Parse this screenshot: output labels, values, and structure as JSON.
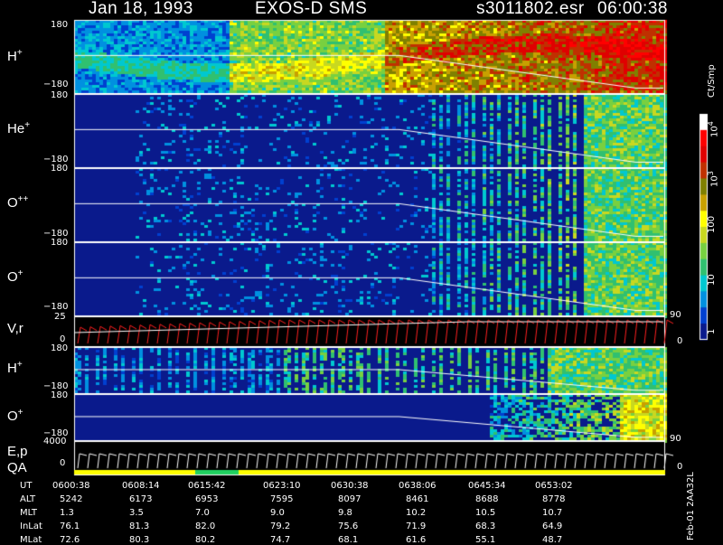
{
  "header": {
    "date": "Jan 18, 1993",
    "instrument": "EXOS-D SMS",
    "file": "s3011802.esr",
    "time": "06:00:38"
  },
  "colorbar": {
    "unit": "Ct/Smp",
    "labels": [
      "10",
      "3",
      "10",
      "4",
      "100",
      "10",
      "1"
    ],
    "exponent_labels": {
      "e3": "3",
      "e4": "4"
    },
    "level_colors": [
      "#0a1a8c",
      "#0040d0",
      "#0090e0",
      "#00c8d0",
      "#30c070",
      "#78d040",
      "#c8d820",
      "#ffff00",
      "#c8a000",
      "#808000",
      "#c03000",
      "#e00000",
      "#ff0000",
      "#ffffff"
    ]
  },
  "footer_note": "Feb-01  2AA32L",
  "chart_data": [
    {
      "type": "heatmap",
      "label": {
        "base": "H",
        "sup": "+"
      },
      "yticks": [
        "180",
        "−180"
      ],
      "ylim": [
        -180,
        180
      ]
    },
    {
      "type": "heatmap",
      "label": {
        "base": "He",
        "sup": "+"
      },
      "yticks": [
        "180",
        "−180"
      ],
      "ylim": [
        -180,
        180
      ]
    },
    {
      "type": "heatmap",
      "label": {
        "base": "O",
        "sup": "++"
      },
      "yticks": [
        "180",
        "−180"
      ],
      "ylim": [
        -180,
        180
      ]
    },
    {
      "type": "heatmap",
      "label": {
        "base": "O",
        "sup": "+"
      },
      "yticks": [
        "180",
        "−180"
      ],
      "ylim": [
        -180,
        180
      ]
    },
    {
      "type": "line",
      "label": {
        "base": "V,r",
        "sup": ""
      },
      "yticks": [
        "25",
        "0"
      ],
      "right_ticks": [
        "90",
        "0"
      ],
      "ylim": [
        0,
        25
      ]
    },
    {
      "type": "heatmap",
      "label": {
        "base": "H",
        "sup": "+"
      },
      "yticks": [
        "180",
        "−180"
      ],
      "ylim": [
        -180,
        180
      ]
    },
    {
      "type": "heatmap",
      "label": {
        "base": "O",
        "sup": "+"
      },
      "yticks": [
        "180",
        "−180"
      ],
      "ylim": [
        -180,
        180
      ],
      "right_ticks": [
        "90"
      ]
    },
    {
      "type": "line",
      "label": {
        "base": "E,p",
        "sup": ""
      },
      "label2": "QA",
      "yticks": [
        "4000",
        "0"
      ],
      "right_ticks": [
        "0"
      ],
      "ylim": [
        0,
        4000
      ]
    }
  ],
  "ephemeris": {
    "rows": [
      {
        "name": "UT",
        "values": [
          "0600:38",
          "0608:14",
          "0615:42",
          "0623:10",
          "0630:38",
          "0638:06",
          "0645:34",
          "0653:02"
        ]
      },
      {
        "name": "ALT",
        "values": [
          "5242",
          "6173",
          "6953",
          "7595",
          "8097",
          "8461",
          "8688",
          "8778"
        ]
      },
      {
        "name": "MLT",
        "values": [
          "1.3",
          "3.5",
          "7.0",
          "9.0",
          "9.8",
          "10.2",
          "10.5",
          "10.7"
        ]
      },
      {
        "name": "InLat",
        "values": [
          "76.1",
          "81.3",
          "82.0",
          "79.2",
          "75.6",
          "71.9",
          "68.3",
          "64.9"
        ]
      },
      {
        "name": "MLat",
        "values": [
          "72.6",
          "80.3",
          "80.2",
          "74.7",
          "68.1",
          "61.6",
          "55.1",
          "48.7"
        ]
      }
    ]
  }
}
